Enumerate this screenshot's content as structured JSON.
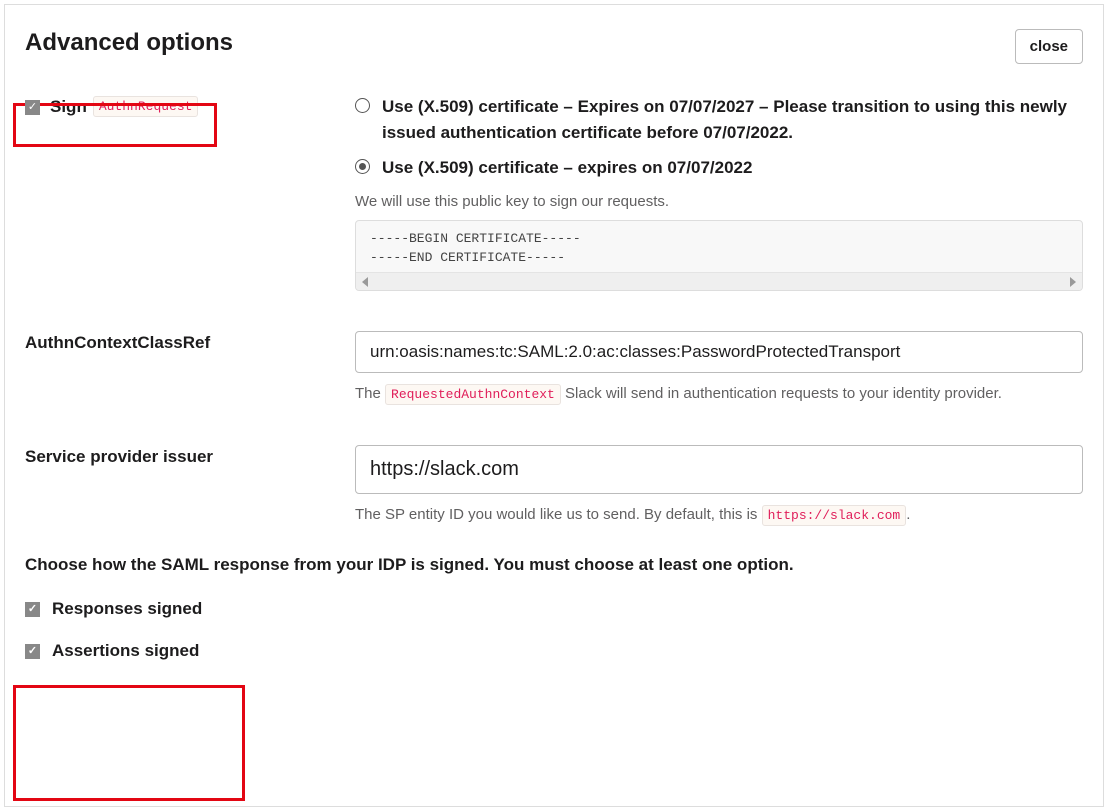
{
  "header": {
    "title": "Advanced options",
    "close_label": "close"
  },
  "sign": {
    "label_prefix": "Sign",
    "label_code": "AuthnRequest",
    "radios": [
      {
        "label": "Use (X.509) certificate – Expires on 07/07/2027 – Please transition to using this newly issued authentication certificate before 07/07/2022.",
        "selected": false
      },
      {
        "label": "Use (X.509) certificate – expires on 07/07/2022",
        "selected": true
      }
    ],
    "cert_help": "We will use this public key to sign our requests.",
    "cert_text": "-----BEGIN CERTIFICATE-----\n-----END CERTIFICATE-----"
  },
  "authn_ctx": {
    "label": "AuthnContextClassRef",
    "value": "urn:oasis:names:tc:SAML:2.0:ac:classes:PasswordProtectedTransport",
    "help_prefix": "The",
    "help_code": "RequestedAuthnContext",
    "help_suffix": "Slack will send in authentication requests to your identity provider."
  },
  "sp_issuer": {
    "label": "Service provider issuer",
    "value": "https://slack.com",
    "help_prefix": "The SP entity ID you would like us to send. By default, this is",
    "help_code": "https://slack.com",
    "help_suffix": "."
  },
  "signing_section": {
    "note": "Choose how the SAML response from your IDP is signed. You must choose at least one option.",
    "responses_label": "Responses signed",
    "assertions_label": "Assertions signed"
  }
}
